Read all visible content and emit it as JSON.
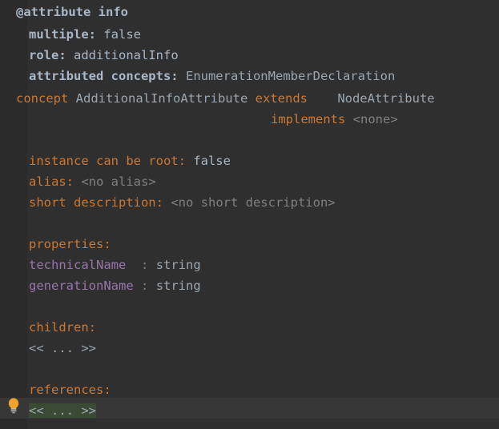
{
  "editor": {
    "background_color": "#2f2f2f",
    "gutter_color": "#2b2b2b",
    "caret_line_color": "#373737",
    "selection_color": "#3a4a35",
    "keyword_color": "#cc7832",
    "identifier_color": "#a9b7c6",
    "property_color": "#9876aa",
    "muted_color": "#808080"
  },
  "gutter": {
    "intention_icon": "lightbulb-icon",
    "intention_icon_color": "#f5a623"
  },
  "code": {
    "header": "@attribute info",
    "multiple_label": "multiple:",
    "multiple_value": "false",
    "role_label": "role:",
    "role_value": "additionalInfo",
    "attributed_concepts_label": "attributed concepts:",
    "attributed_concepts_value": "EnumerationMemberDeclaration",
    "concept_keyword": "concept",
    "concept_name": "AdditionalInfoAttribute",
    "extends_keyword": "extends",
    "extends_value": "NodeAttribute",
    "implements_keyword": "implements",
    "implements_value": "<none>",
    "instance_can_be_root_label": "instance can be root:",
    "instance_can_be_root_value": "false",
    "alias_label": "alias:",
    "alias_value": "<no alias>",
    "short_description_label": "short description:",
    "short_description_value": "<no short description>",
    "properties_header": "properties:",
    "properties": [
      {
        "name": "technicalName",
        "colon": ":",
        "type": "string"
      },
      {
        "name": "generationName",
        "colon": ":",
        "type": "string"
      }
    ],
    "children_header": "children:",
    "children_collapsed": "<< ... >>",
    "references_header": "references:",
    "references_collapsed": "<< ... >>"
  }
}
